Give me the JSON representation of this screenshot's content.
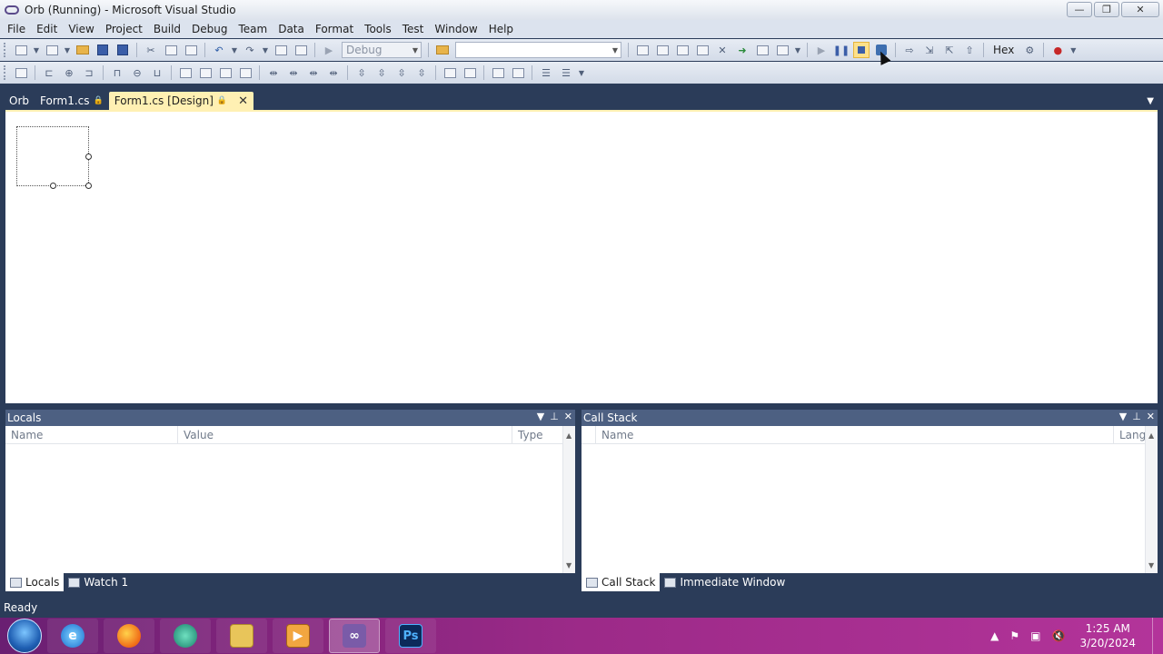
{
  "window": {
    "title": "Orb (Running) - Microsoft Visual Studio",
    "controls": {
      "minimize": "—",
      "maximize": "❐",
      "close": "✕"
    }
  },
  "menu": [
    "File",
    "Edit",
    "View",
    "Project",
    "Build",
    "Debug",
    "Team",
    "Data",
    "Format",
    "Tools",
    "Test",
    "Window",
    "Help"
  ],
  "toolbar": {
    "config_value": "Debug",
    "platform_value": "",
    "hex_label": "Hex"
  },
  "tabs": {
    "items": [
      {
        "label": "Orb"
      },
      {
        "label": "Form1.cs"
      },
      {
        "label": "Form1.cs [Design]"
      }
    ],
    "close_glyph": "✕"
  },
  "locals": {
    "title": "Locals",
    "columns": [
      "Name",
      "Value",
      "Type"
    ]
  },
  "callstack": {
    "title": "Call Stack",
    "columns": [
      "Name",
      "Lang"
    ]
  },
  "bottom_tabs_left": [
    {
      "label": "Locals"
    },
    {
      "label": "Watch 1"
    }
  ],
  "bottom_tabs_right": [
    {
      "label": "Call Stack"
    },
    {
      "label": "Immediate Window"
    }
  ],
  "status": {
    "text": "Ready"
  },
  "taskbar": {
    "ps_label": "Ps",
    "time": "1:25 AM",
    "date": "3/20/2024"
  },
  "colors": {
    "vs_chrome": "#2b3c59",
    "active_tab": "#fff0b3",
    "taskbar": "#9c2a88"
  }
}
